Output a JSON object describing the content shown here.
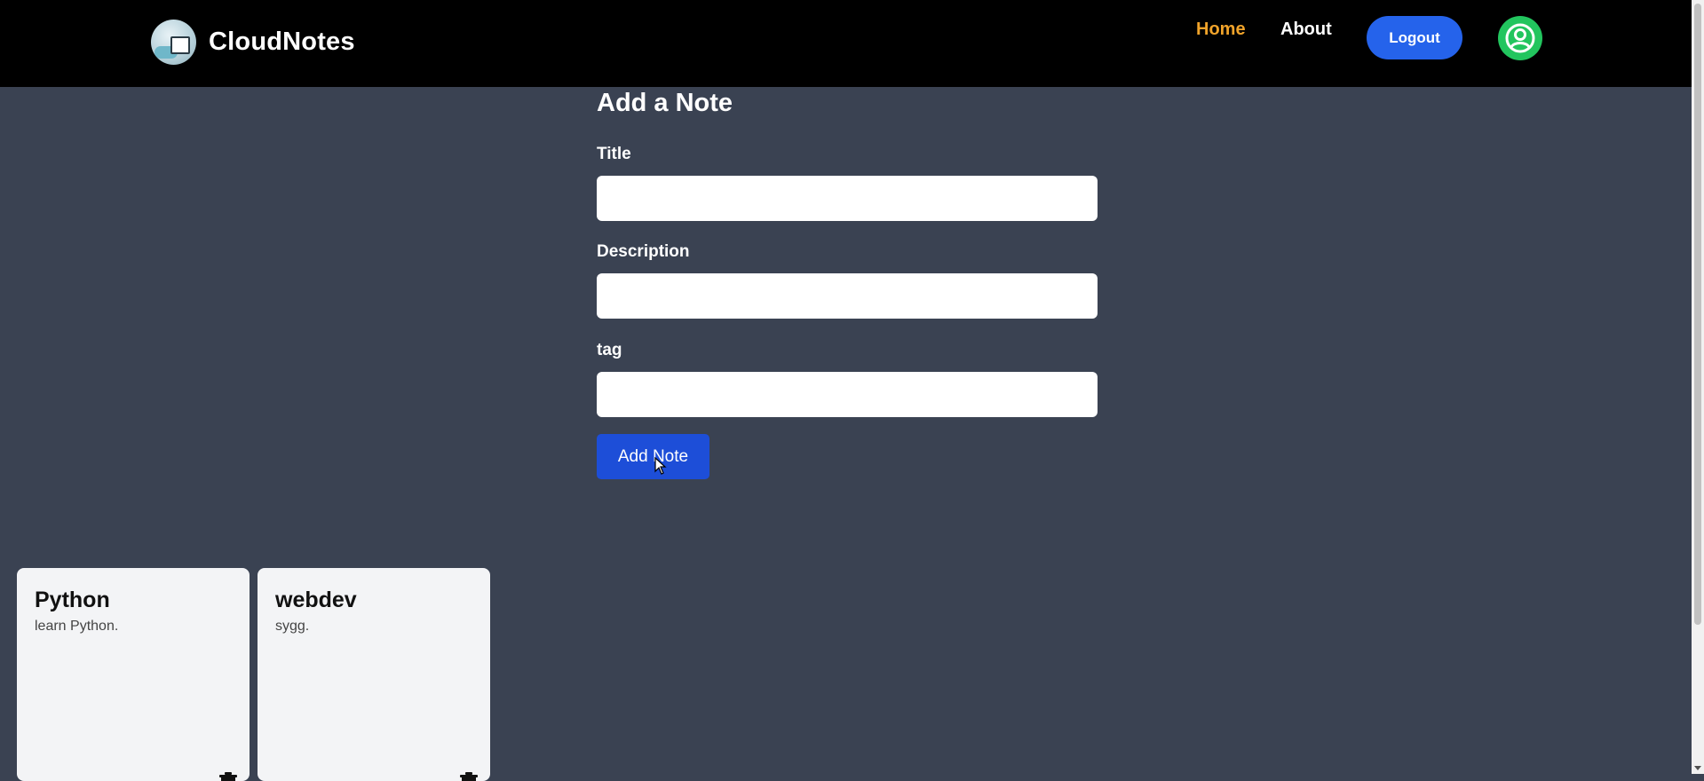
{
  "navbar": {
    "brand_name": "CloudNotes",
    "links": {
      "home": "Home",
      "about": "About"
    },
    "logout_label": "Logout",
    "active_link_color": "#f0a32a",
    "avatar_icon": "user-circle-icon"
  },
  "form": {
    "heading": "Add a Note",
    "title_label": "Title",
    "title_value": "",
    "description_label": "Description",
    "description_value": "",
    "tag_label": "tag",
    "tag_value": "",
    "submit_label": "Add Note"
  },
  "notes": [
    {
      "title": "Python",
      "description": "learn Python."
    },
    {
      "title": "webdev",
      "description": "sygg."
    }
  ],
  "colors": {
    "background": "#3a4252",
    "navbar": "#000000",
    "primary_button": "#1d4ed8",
    "avatar": "#22c55e",
    "card": "#f3f4f6"
  }
}
